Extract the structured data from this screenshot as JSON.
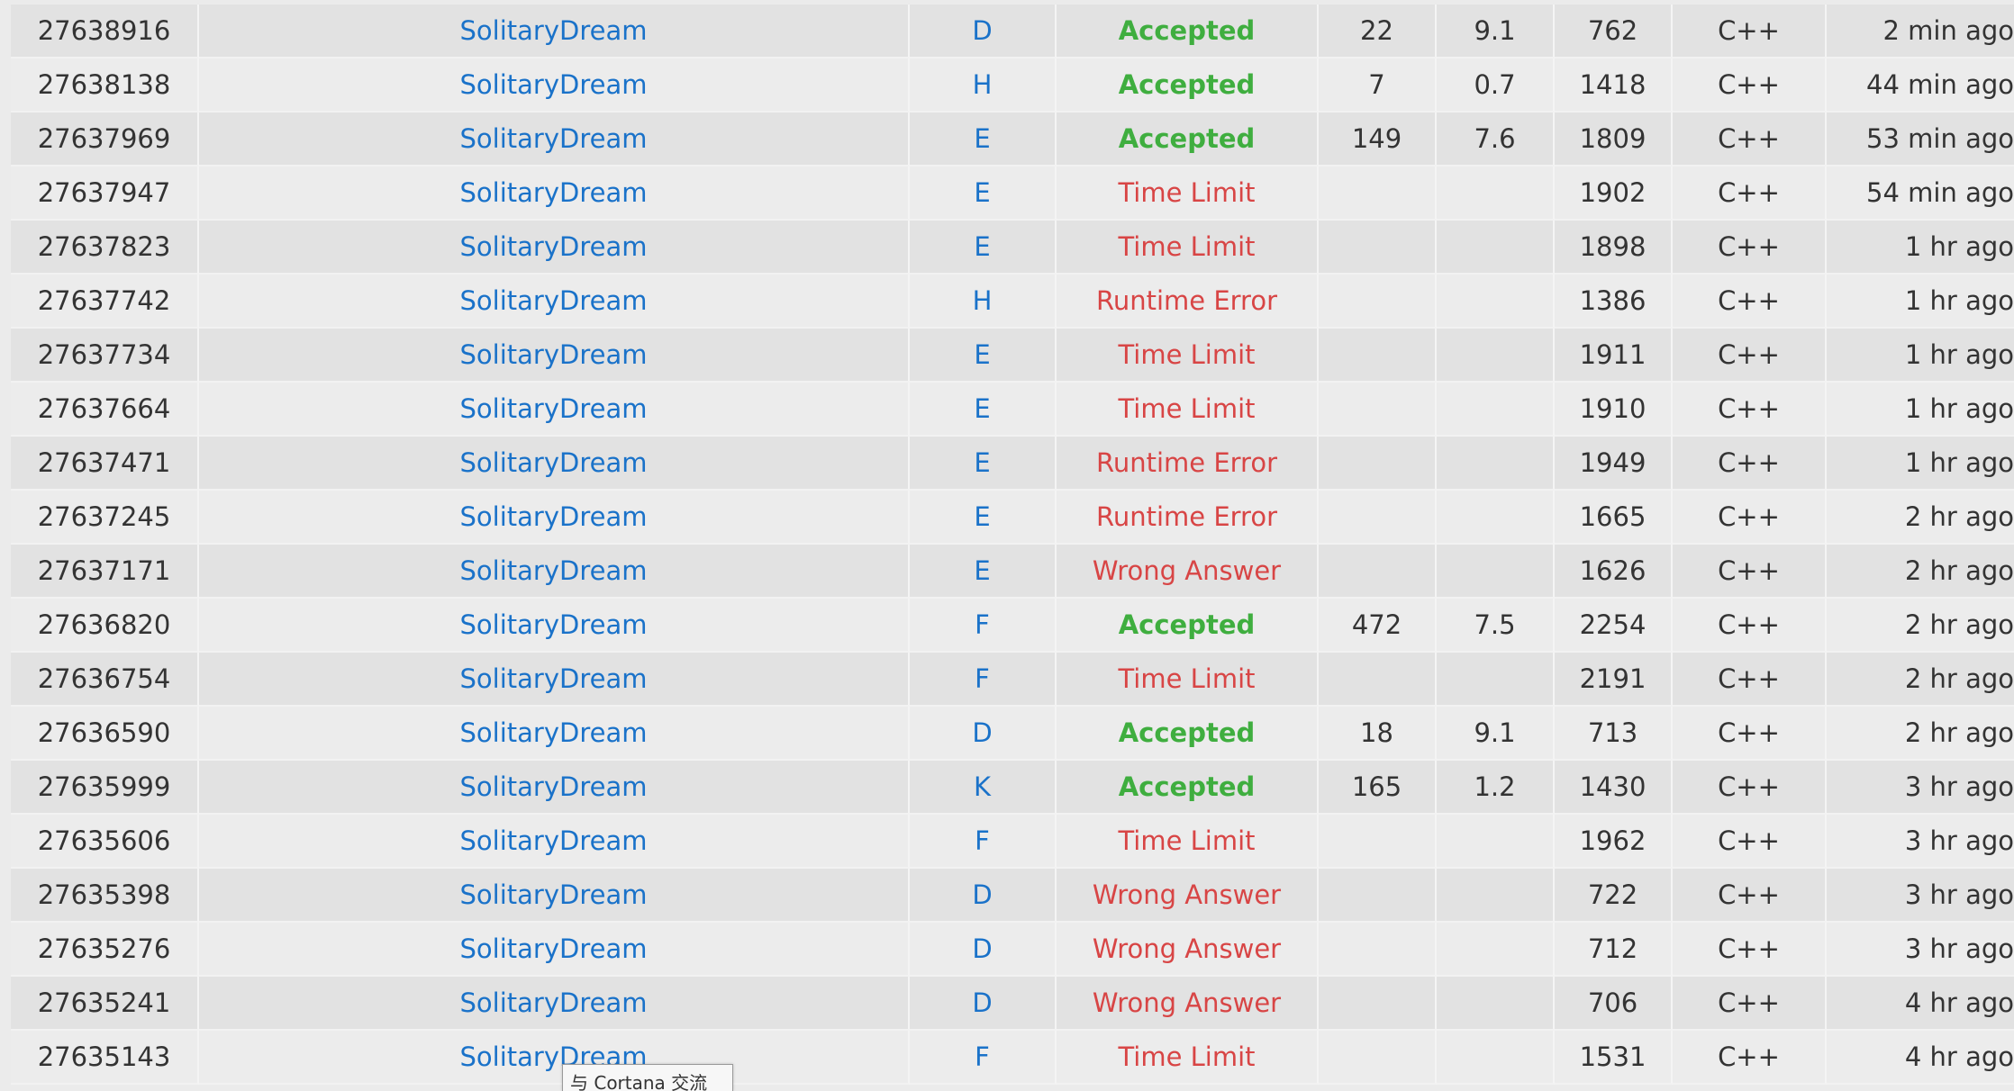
{
  "submissions": [
    {
      "id": "27638916",
      "user": "SolitaryDream",
      "problem": "D",
      "verdict": "Accepted",
      "accepted": true,
      "time": "22",
      "score": "9.1",
      "length": "762",
      "lang": "C++",
      "when": "2 min ago"
    },
    {
      "id": "27638138",
      "user": "SolitaryDream",
      "problem": "H",
      "verdict": "Accepted",
      "accepted": true,
      "time": "7",
      "score": "0.7",
      "length": "1418",
      "lang": "C++",
      "when": "44 min ago"
    },
    {
      "id": "27637969",
      "user": "SolitaryDream",
      "problem": "E",
      "verdict": "Accepted",
      "accepted": true,
      "time": "149",
      "score": "7.6",
      "length": "1809",
      "lang": "C++",
      "when": "53 min ago"
    },
    {
      "id": "27637947",
      "user": "SolitaryDream",
      "problem": "E",
      "verdict": "Time Limit",
      "accepted": false,
      "time": "",
      "score": "",
      "length": "1902",
      "lang": "C++",
      "when": "54 min ago"
    },
    {
      "id": "27637823",
      "user": "SolitaryDream",
      "problem": "E",
      "verdict": "Time Limit",
      "accepted": false,
      "time": "",
      "score": "",
      "length": "1898",
      "lang": "C++",
      "when": "1 hr ago"
    },
    {
      "id": "27637742",
      "user": "SolitaryDream",
      "problem": "H",
      "verdict": "Runtime Error",
      "accepted": false,
      "time": "",
      "score": "",
      "length": "1386",
      "lang": "C++",
      "when": "1 hr ago"
    },
    {
      "id": "27637734",
      "user": "SolitaryDream",
      "problem": "E",
      "verdict": "Time Limit",
      "accepted": false,
      "time": "",
      "score": "",
      "length": "1911",
      "lang": "C++",
      "when": "1 hr ago"
    },
    {
      "id": "27637664",
      "user": "SolitaryDream",
      "problem": "E",
      "verdict": "Time Limit",
      "accepted": false,
      "time": "",
      "score": "",
      "length": "1910",
      "lang": "C++",
      "when": "1 hr ago"
    },
    {
      "id": "27637471",
      "user": "SolitaryDream",
      "problem": "E",
      "verdict": "Runtime Error",
      "accepted": false,
      "time": "",
      "score": "",
      "length": "1949",
      "lang": "C++",
      "when": "1 hr ago"
    },
    {
      "id": "27637245",
      "user": "SolitaryDream",
      "problem": "E",
      "verdict": "Runtime Error",
      "accepted": false,
      "time": "",
      "score": "",
      "length": "1665",
      "lang": "C++",
      "when": "2 hr ago"
    },
    {
      "id": "27637171",
      "user": "SolitaryDream",
      "problem": "E",
      "verdict": "Wrong Answer",
      "accepted": false,
      "time": "",
      "score": "",
      "length": "1626",
      "lang": "C++",
      "when": "2 hr ago"
    },
    {
      "id": "27636820",
      "user": "SolitaryDream",
      "problem": "F",
      "verdict": "Accepted",
      "accepted": true,
      "time": "472",
      "score": "7.5",
      "length": "2254",
      "lang": "C++",
      "when": "2 hr ago"
    },
    {
      "id": "27636754",
      "user": "SolitaryDream",
      "problem": "F",
      "verdict": "Time Limit",
      "accepted": false,
      "time": "",
      "score": "",
      "length": "2191",
      "lang": "C++",
      "when": "2 hr ago"
    },
    {
      "id": "27636590",
      "user": "SolitaryDream",
      "problem": "D",
      "verdict": "Accepted",
      "accepted": true,
      "time": "18",
      "score": "9.1",
      "length": "713",
      "lang": "C++",
      "when": "2 hr ago"
    },
    {
      "id": "27635999",
      "user": "SolitaryDream",
      "problem": "K",
      "verdict": "Accepted",
      "accepted": true,
      "time": "165",
      "score": "1.2",
      "length": "1430",
      "lang": "C++",
      "when": "3 hr ago"
    },
    {
      "id": "27635606",
      "user": "SolitaryDream",
      "problem": "F",
      "verdict": "Time Limit",
      "accepted": false,
      "time": "",
      "score": "",
      "length": "1962",
      "lang": "C++",
      "when": "3 hr ago"
    },
    {
      "id": "27635398",
      "user": "SolitaryDream",
      "problem": "D",
      "verdict": "Wrong Answer",
      "accepted": false,
      "time": "",
      "score": "",
      "length": "722",
      "lang": "C++",
      "when": "3 hr ago"
    },
    {
      "id": "27635276",
      "user": "SolitaryDream",
      "problem": "D",
      "verdict": "Wrong Answer",
      "accepted": false,
      "time": "",
      "score": "",
      "length": "712",
      "lang": "C++",
      "when": "3 hr ago"
    },
    {
      "id": "27635241",
      "user": "SolitaryDream",
      "problem": "D",
      "verdict": "Wrong Answer",
      "accepted": false,
      "time": "",
      "score": "",
      "length": "706",
      "lang": "C++",
      "when": "4 hr ago"
    },
    {
      "id": "27635143",
      "user": "SolitaryDream",
      "problem": "F",
      "verdict": "Time Limit",
      "accepted": false,
      "time": "",
      "score": "",
      "length": "1531",
      "lang": "C++",
      "when": "4 hr ago"
    }
  ],
  "tooltip": {
    "text": "与 Cortana 交流"
  },
  "colors": {
    "link": "#1a72c9",
    "accepted": "#3fae3f",
    "rejected": "#d84545",
    "row_odd": "#e2e2e2",
    "row_even": "#ececec"
  }
}
